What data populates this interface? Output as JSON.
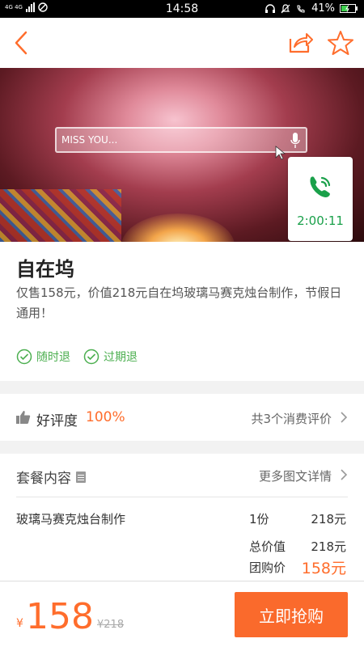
{
  "status_bar": {
    "network": "4G 4G",
    "time": "14:58",
    "battery": "41%"
  },
  "icons": {
    "back": "chevron-left-icon",
    "share": "share-icon",
    "favorite": "star-icon",
    "phone": "phone-call-icon",
    "check": "check-circle-icon",
    "thumb": "thumbs-up-icon",
    "chevron": "chevron-right-icon"
  },
  "hero": {
    "search_text": "MISS YOU..."
  },
  "timer": {
    "time": "2:00:11"
  },
  "deal": {
    "name": "自在坞",
    "description": "仅售158元，价值218元自在坞玻璃马赛克烛台制作，节假日通用！",
    "tags": [
      "随时退",
      "过期退"
    ]
  },
  "rating": {
    "label": "好评度",
    "percent": "100%",
    "review_count": "共3个消费评价"
  },
  "package": {
    "title": "套餐内容",
    "more_link": "更多图文详情",
    "item_name": "玻璃马赛克烛台制作",
    "item_qty": "1份",
    "item_price": "218元",
    "total_label": "总价值",
    "total_value": "218元",
    "group_label": "团购价",
    "group_value": "158元"
  },
  "bottom": {
    "currency": "¥",
    "price": "158",
    "original_price": "¥218",
    "buy_label": "立即抢购"
  },
  "colors": {
    "accent": "#ff6d2c",
    "green": "#4caf50"
  }
}
